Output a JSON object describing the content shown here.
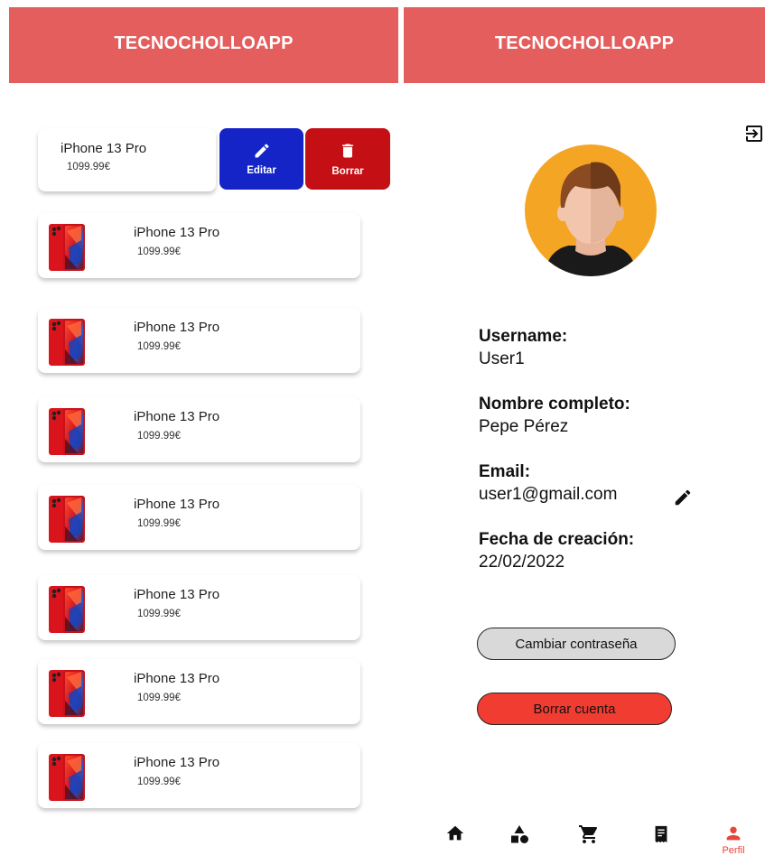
{
  "colors": {
    "header_bg": "#e55e5e",
    "edit_bg": "#1424c7",
    "delete_bg": "#c40f15",
    "change_pass_bg": "#d9d9d9",
    "delete_account_bg": "#f13c32",
    "nav_active": "#e8443a"
  },
  "left_screen": {
    "header_title": "TECNOCHOLLOAPP",
    "swiped_item": {
      "name": "iPhone 13 Pro",
      "price": "1099.99€",
      "edit_label": "Editar",
      "delete_label": "Borrar",
      "edit_icon": "pencil-icon",
      "delete_icon": "trash-icon"
    },
    "products": [
      {
        "name": "iPhone 13 Pro",
        "price": "1099.99€"
      },
      {
        "name": "iPhone 13 Pro",
        "price": "1099.99€"
      },
      {
        "name": "iPhone 13 Pro",
        "price": "1099.99€"
      },
      {
        "name": "iPhone 13 Pro",
        "price": "1099.99€"
      },
      {
        "name": "iPhone 13 Pro",
        "price": "1099.99€"
      },
      {
        "name": "iPhone 13 Pro",
        "price": "1099.99€"
      },
      {
        "name": "iPhone 13 Pro",
        "price": "1099.99€"
      }
    ]
  },
  "right_screen": {
    "header_title": "TECNOCHOLLOAPP",
    "logout_icon": "logout-icon",
    "username_label": "Username:",
    "username_value": "User1",
    "fullname_label": "Nombre completo:",
    "fullname_value": "Pepe Pérez",
    "email_label": "Email:",
    "email_value": "user1@gmail.com",
    "created_label": "Fecha de creación:",
    "created_value": "22/02/2022",
    "change_password_button": "Cambiar contraseña",
    "delete_account_button": "Borrar cuenta",
    "nav": [
      {
        "icon": "home-icon",
        "label": ""
      },
      {
        "icon": "categories-icon",
        "label": ""
      },
      {
        "icon": "cart-icon",
        "label": ""
      },
      {
        "icon": "orders-icon",
        "label": ""
      },
      {
        "icon": "person-icon",
        "label": "Perfil",
        "active": true
      }
    ]
  }
}
